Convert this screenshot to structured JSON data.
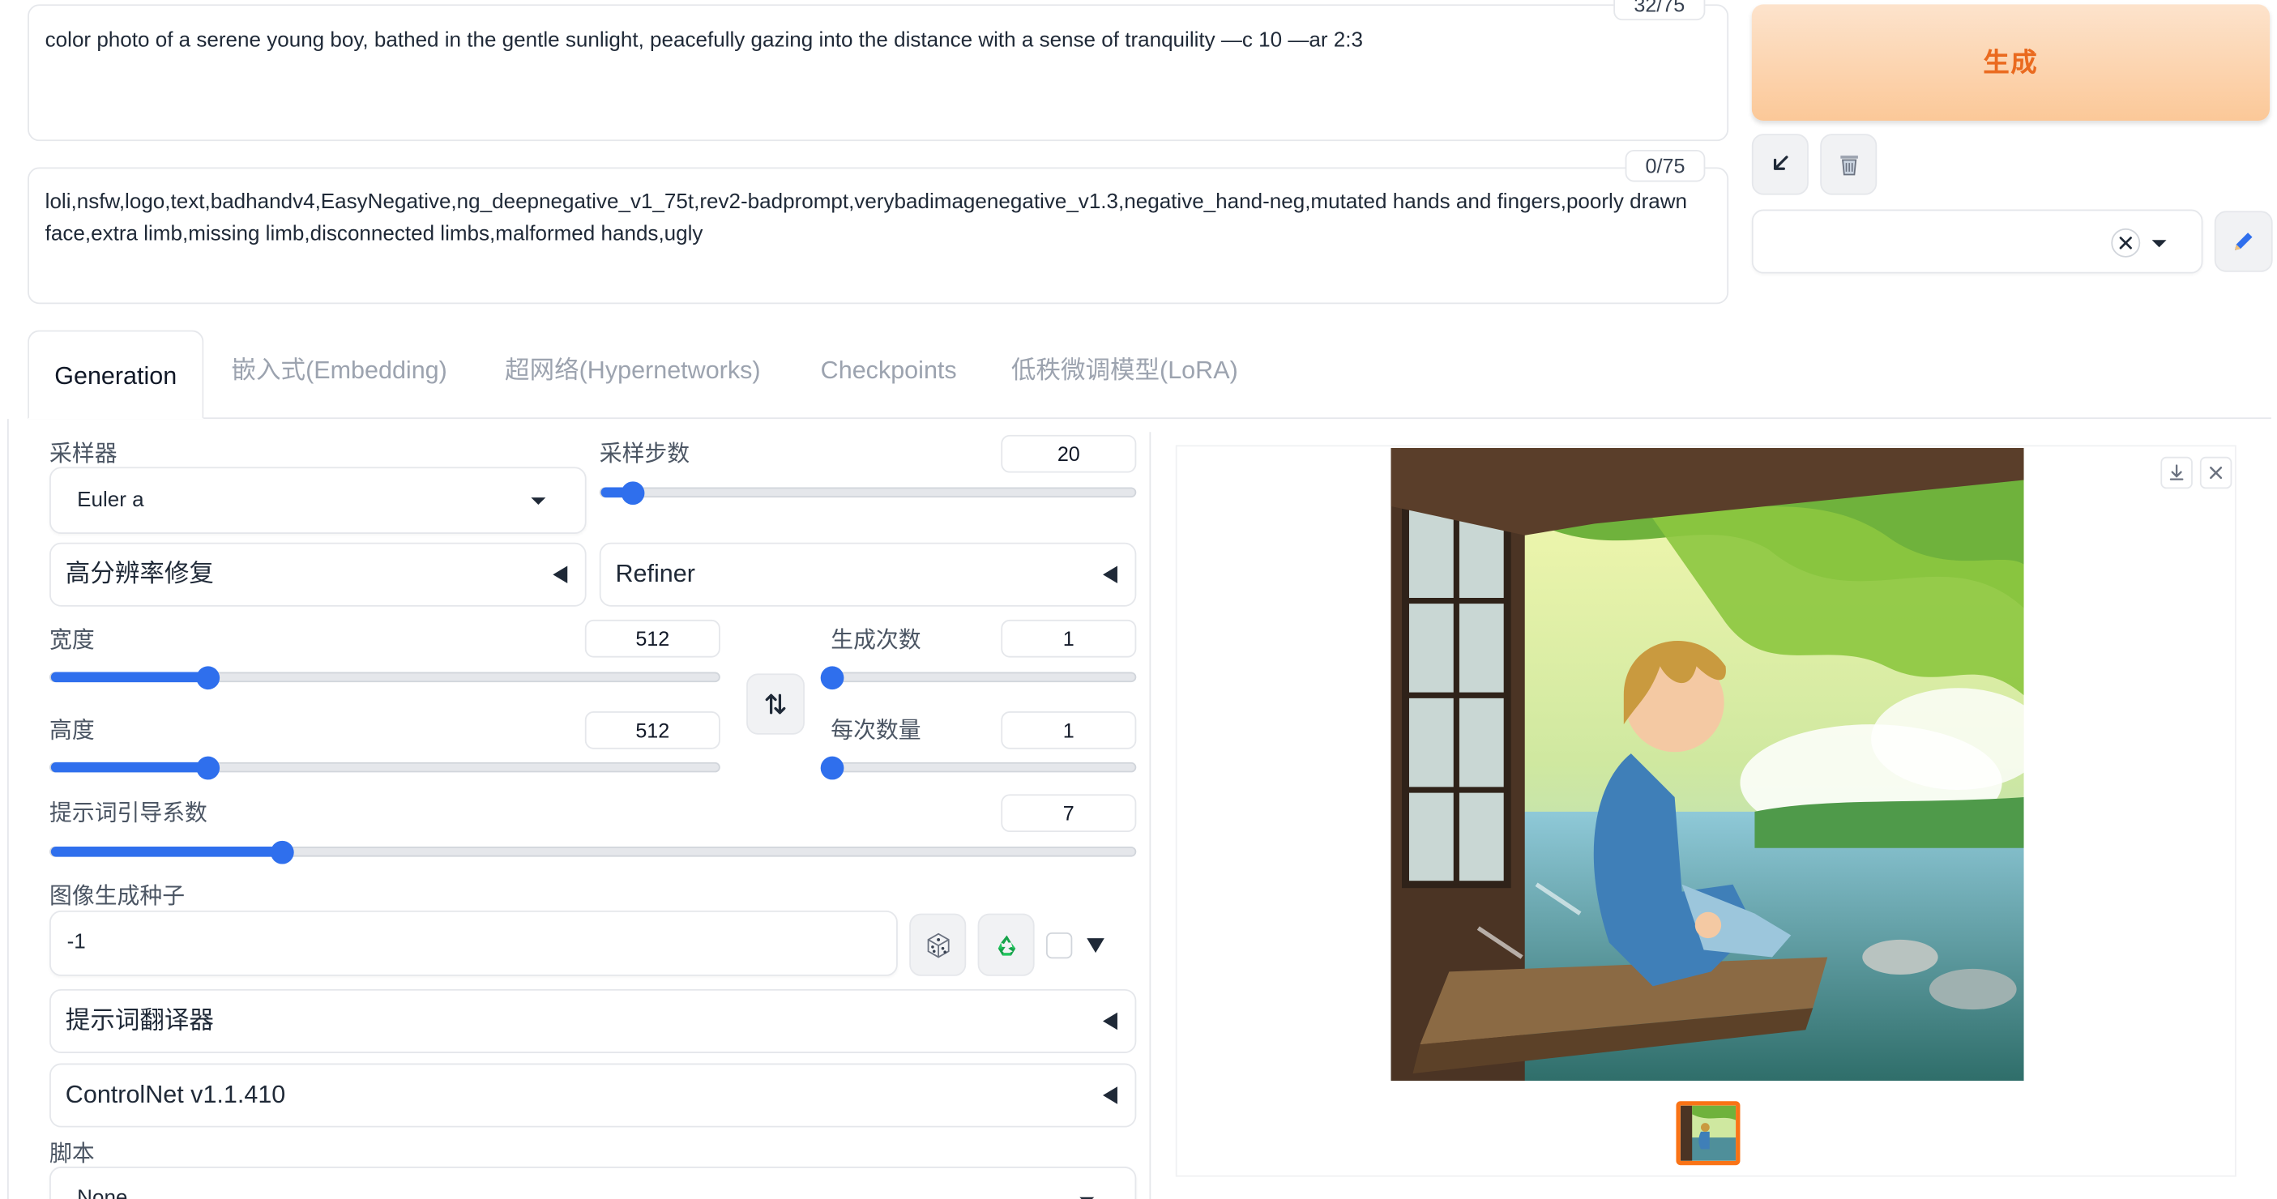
{
  "prompt": {
    "counter": "32/75",
    "text": "color photo of a serene young boy, bathed in the gentle sunlight, peacefully gazing into the distance with a sense of tranquility —c 10 —ar 2:3"
  },
  "negative_prompt": {
    "counter": "0/75",
    "text": "loli,nsfw,logo,text,badhandv4,EasyNegative,ng_deepnegative_v1_75t,rev2-badprompt,verybadimagenegative_v1.3,negative_hand-neg,mutated hands and fingers,poorly drawn face,extra limb,missing limb,disconnected limbs,malformed hands,ugly"
  },
  "generate_button": "生成",
  "tabs": [
    {
      "label": "Generation"
    },
    {
      "label": "嵌入式(Embedding)"
    },
    {
      "label": "超网络(Hypernetworks)"
    },
    {
      "label": "Checkpoints"
    },
    {
      "label": "低秩微调模型(LoRA)"
    }
  ],
  "sampler": {
    "label": "采样器",
    "value": "Euler a"
  },
  "steps": {
    "label": "采样步数",
    "value": "20",
    "fraction": 0.06
  },
  "hires_fix": {
    "label": "高分辨率修复"
  },
  "refiner": {
    "label": "Refiner"
  },
  "width": {
    "label": "宽度",
    "value": "512",
    "fraction": 0.236
  },
  "height": {
    "label": "高度",
    "value": "512",
    "fraction": 0.236
  },
  "batch_count": {
    "label": "生成次数",
    "value": "1",
    "fraction": 0.0
  },
  "batch_size": {
    "label": "每次数量",
    "value": "1",
    "fraction": 0.0
  },
  "cfg_scale": {
    "label": "提示词引导系数",
    "value": "7",
    "fraction": 0.214
  },
  "seed": {
    "label": "图像生成种子",
    "value": "-1"
  },
  "prompt_translator": {
    "label": "提示词翻译器"
  },
  "controlnet": {
    "label": "ControlNet v1.1.410"
  },
  "script": {
    "label": "脚本",
    "value": "None"
  },
  "icons": {
    "paste": "arrow-down-left-icon",
    "trash": "trash-icon",
    "clear": "close-circle-icon",
    "edit": "pencil-icon",
    "swap": "swap-vertical-icon",
    "dice": "dice-icon",
    "recycle": "recycle-icon",
    "download": "download-icon",
    "close": "close-icon"
  },
  "colors": {
    "accent": "#2f6fed",
    "generate_text": "#ea6a1f",
    "generate_bg": "#fbc898"
  }
}
